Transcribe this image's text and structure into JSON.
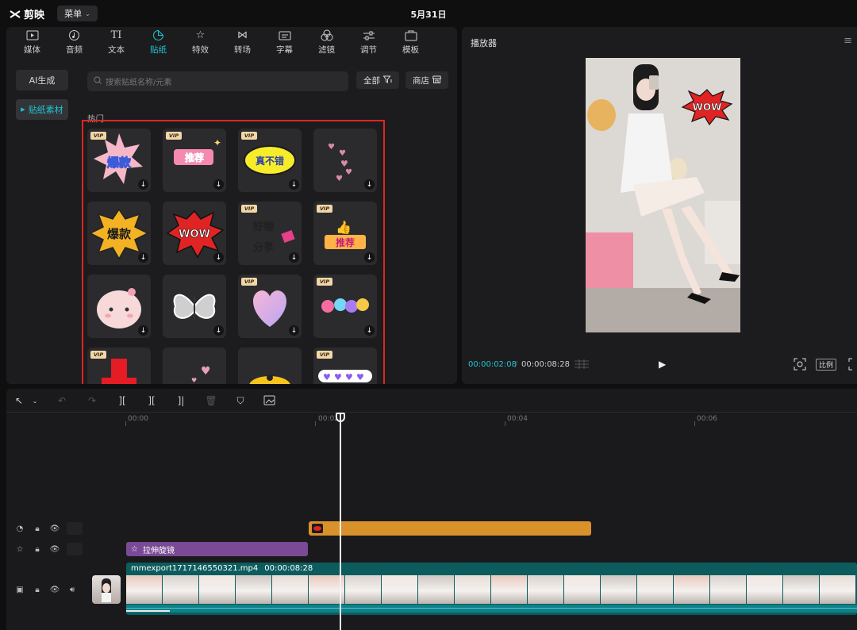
{
  "app": {
    "name": "剪映",
    "menu_label": "菜单",
    "doc_title": "5月31日"
  },
  "tabs": [
    {
      "label": "媒体",
      "icon": "media-icon"
    },
    {
      "label": "音频",
      "icon": "audio-icon"
    },
    {
      "label": "文本",
      "icon": "text-icon"
    },
    {
      "label": "贴纸",
      "icon": "sticker-icon",
      "active": true
    },
    {
      "label": "特效",
      "icon": "effects-icon"
    },
    {
      "label": "转场",
      "icon": "transition-icon"
    },
    {
      "label": "字幕",
      "icon": "subtitle-icon"
    },
    {
      "label": "滤镜",
      "icon": "filter-icon"
    },
    {
      "label": "调节",
      "icon": "adjust-icon"
    },
    {
      "label": "模板",
      "icon": "template-icon"
    }
  ],
  "side": {
    "ai": "AI生成",
    "materials": "贴纸素材"
  },
  "search": {
    "placeholder": "搜索贴纸名称/元素"
  },
  "filter": {
    "all": "全部",
    "shop": "商店"
  },
  "section": {
    "hot": "热门"
  },
  "stickers": [
    {
      "name": "baokuan-sticker",
      "vip": true
    },
    {
      "name": "tuijian-sticker",
      "vip": true
    },
    {
      "name": "zhenbucuo-sticker",
      "vip": true
    },
    {
      "name": "hearts-sticker",
      "vip": false
    },
    {
      "name": "baokuan-burst-sticker",
      "vip": false
    },
    {
      "name": "wow-sticker",
      "vip": false
    },
    {
      "name": "haowu-fenxiang-sticker",
      "vip": true
    },
    {
      "name": "tuijian-thumb-sticker",
      "vip": true
    },
    {
      "name": "bun-face-sticker",
      "vip": false
    },
    {
      "name": "butterfly-sticker",
      "vip": false
    },
    {
      "name": "heart-3d-sticker",
      "vip": true
    },
    {
      "name": "flowers-sticker",
      "vip": true
    },
    {
      "name": "red-block-sticker",
      "vip": true
    },
    {
      "name": "small-hearts-sticker",
      "vip": false
    },
    {
      "name": "sunflower-sticker",
      "vip": false
    },
    {
      "name": "purple-hearts-sticker",
      "vip": true
    }
  ],
  "vip_label": "VIP",
  "sticker_text": {
    "baokuan": "爆款",
    "tuijian": "推荐",
    "zhenbucuo": "真不错",
    "wow": "WOW",
    "haowu": "好物",
    "fenxiang": "分享"
  },
  "player": {
    "title": "播放器",
    "current_time": "00:00:02:08",
    "total_time": "00:00:08:28",
    "ratio_label": "比例",
    "overlay_text": "WOW"
  },
  "ruler": [
    "00:00",
    "00:02",
    "00:04",
    "00:06"
  ],
  "timeline": {
    "filter_clip_label": "拉伸旋镜",
    "video_clip_name": "mmexport1717146550321.mp4",
    "video_clip_duration": "00:00:08:28"
  },
  "colors": {
    "accent": "#1fc7d4",
    "highlight_border": "#e02424",
    "sticker_clip": "#d9912c",
    "filter_clip": "#7a4a96",
    "video_clip": "#0c5c5e"
  }
}
